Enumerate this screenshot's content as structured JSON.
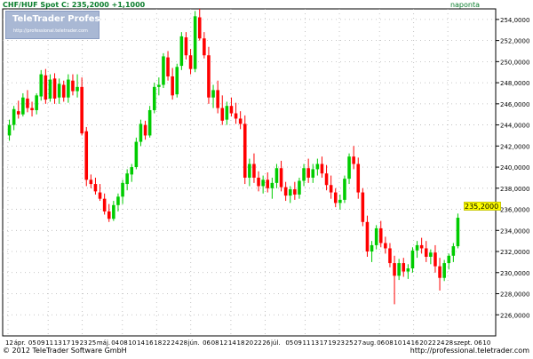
{
  "header": {
    "symbol_line": "CHF/HUF Spot C: 235,2000 +1,1000",
    "frequency": "naponta"
  },
  "logo": {
    "title": "TeleTrader Professional",
    "url": "http://professional.teletrader.com"
  },
  "footer": {
    "copyright": "© 2012 TeleTrader Software GmbH",
    "url": "http://professional.teletrader.com"
  },
  "colors": {
    "up": "#00cc00",
    "down": "#ff0000",
    "grid": "#b5b5b5",
    "axis": "#000000",
    "last_price_bg": "#ffff00"
  },
  "chart_data": {
    "type": "candlestick",
    "title": "CHF/HUF Spot",
    "last_price_label": "235,2000",
    "ylim": [
      224,
      255
    ],
    "y_ticks": [
      "226,0000",
      "228,0000",
      "230,0000",
      "232,0000",
      "234,0000",
      "236,0000",
      "238,0000",
      "240,0000",
      "242,0000",
      "244,0000",
      "246,0000",
      "248,0000",
      "250,0000",
      "252,0000",
      "254,0000"
    ],
    "x_tick_labels": [
      "12",
      "ápr.",
      "05",
      "09",
      "11",
      "13",
      "17",
      "19",
      "23",
      "25",
      "máj.",
      "04",
      "08",
      "10",
      "14",
      "16",
      "18",
      "22",
      "24",
      "28",
      "jún.",
      "06",
      "08",
      "12",
      "14",
      "18",
      "20",
      "22",
      "26",
      "júl.",
      "05",
      "09",
      "11",
      "13",
      "17",
      "19",
      "23",
      "25",
      "27",
      "aug.",
      "06",
      "08",
      "10",
      "14",
      "16",
      "20",
      "22",
      "24",
      "28",
      "szept.",
      "06",
      "10"
    ],
    "grid": true,
    "axis_side": "right",
    "candles": [
      [
        243.0,
        244.5,
        242.5,
        244.0
      ],
      [
        244.0,
        245.8,
        243.5,
        245.5
      ],
      [
        245.3,
        246.3,
        244.6,
        245.0
      ],
      [
        245.0,
        247.0,
        244.8,
        246.6
      ],
      [
        246.5,
        247.3,
        245.2,
        245.6
      ],
      [
        245.6,
        246.2,
        244.8,
        245.4
      ],
      [
        245.4,
        247.0,
        245.0,
        246.8
      ],
      [
        246.7,
        249.2,
        246.3,
        248.8
      ],
      [
        248.7,
        249.3,
        246.0,
        246.4
      ],
      [
        246.5,
        248.8,
        246.2,
        248.3
      ],
      [
        248.4,
        248.9,
        246.0,
        246.5
      ],
      [
        246.6,
        248.4,
        246.0,
        247.9
      ],
      [
        247.8,
        248.2,
        246.2,
        246.6
      ],
      [
        246.6,
        248.8,
        246.1,
        248.3
      ],
      [
        248.2,
        248.8,
        246.8,
        247.2
      ],
      [
        247.2,
        248.8,
        246.6,
        247.6
      ],
      [
        247.6,
        248.5,
        243.0,
        243.2
      ],
      [
        243.4,
        243.8,
        238.2,
        238.8
      ],
      [
        238.8,
        239.3,
        238.0,
        238.4
      ],
      [
        238.4,
        239.0,
        237.4,
        237.7
      ],
      [
        237.6,
        238.4,
        236.8,
        237.0
      ],
      [
        237.0,
        237.5,
        235.5,
        235.8
      ],
      [
        235.8,
        236.5,
        234.8,
        235.1
      ],
      [
        235.1,
        236.8,
        234.9,
        236.4
      ],
      [
        236.4,
        237.5,
        235.8,
        237.2
      ],
      [
        237.2,
        238.8,
        236.5,
        238.5
      ],
      [
        238.4,
        239.8,
        237.8,
        239.4
      ],
      [
        239.3,
        240.3,
        238.6,
        240.0
      ],
      [
        240.0,
        242.8,
        239.8,
        242.4
      ],
      [
        242.4,
        244.5,
        242.0,
        244.1
      ],
      [
        244.0,
        244.4,
        242.6,
        243.0
      ],
      [
        243.0,
        245.8,
        242.8,
        245.4
      ],
      [
        245.4,
        248.0,
        245.1,
        247.6
      ],
      [
        247.6,
        248.5,
        246.8,
        247.8
      ],
      [
        247.8,
        250.8,
        247.5,
        250.5
      ],
      [
        250.4,
        251.0,
        248.2,
        248.6
      ],
      [
        248.6,
        249.4,
        246.4,
        246.8
      ],
      [
        246.9,
        249.8,
        246.6,
        249.5
      ],
      [
        249.6,
        252.8,
        249.2,
        252.4
      ],
      [
        252.3,
        252.8,
        250.2,
        250.6
      ],
      [
        250.6,
        251.2,
        248.8,
        249.3
      ],
      [
        249.3,
        254.8,
        249.0,
        254.3
      ],
      [
        254.2,
        255.0,
        252.0,
        252.2
      ],
      [
        252.2,
        252.8,
        250.3,
        250.6
      ],
      [
        250.6,
        251.4,
        246.0,
        246.6
      ],
      [
        246.6,
        247.8,
        245.6,
        247.3
      ],
      [
        247.3,
        248.2,
        245.1,
        245.6
      ],
      [
        245.6,
        246.8,
        244.0,
        244.4
      ],
      [
        244.5,
        246.2,
        244.0,
        245.8
      ],
      [
        245.8,
        246.6,
        244.8,
        245.1
      ],
      [
        245.1,
        246.1,
        244.1,
        244.6
      ],
      [
        244.6,
        245.3,
        243.6,
        244.1
      ],
      [
        244.1,
        244.9,
        238.4,
        239.0
      ],
      [
        239.0,
        240.8,
        238.2,
        240.3
      ],
      [
        240.3,
        241.3,
        238.5,
        239.0
      ],
      [
        239.0,
        239.6,
        237.7,
        238.2
      ],
      [
        238.2,
        239.2,
        237.5,
        238.8
      ],
      [
        238.8,
        239.5,
        237.6,
        238.0
      ],
      [
        238.0,
        239.0,
        237.0,
        238.5
      ],
      [
        238.5,
        240.3,
        238.0,
        239.9
      ],
      [
        239.9,
        240.6,
        237.7,
        238.1
      ],
      [
        238.1,
        238.6,
        236.8,
        237.3
      ],
      [
        237.3,
        238.2,
        236.6,
        237.9
      ],
      [
        237.9,
        238.6,
        236.9,
        237.4
      ],
      [
        237.4,
        239.0,
        237.0,
        238.7
      ],
      [
        238.7,
        240.3,
        238.2,
        239.9
      ],
      [
        239.9,
        240.8,
        238.5,
        239.0
      ],
      [
        239.0,
        240.3,
        238.5,
        239.8
      ],
      [
        239.8,
        240.8,
        239.2,
        240.3
      ],
      [
        240.3,
        241.0,
        239.0,
        239.4
      ],
      [
        239.4,
        240.2,
        237.8,
        238.3
      ],
      [
        238.3,
        239.2,
        237.0,
        237.6
      ],
      [
        237.6,
        238.0,
        236.2,
        236.6
      ],
      [
        236.6,
        237.4,
        236.0,
        236.9
      ],
      [
        236.9,
        239.2,
        236.6,
        238.9
      ],
      [
        238.9,
        241.3,
        238.4,
        241.0
      ],
      [
        241.0,
        242.0,
        239.8,
        240.3
      ],
      [
        240.3,
        240.9,
        237.0,
        237.6
      ],
      [
        237.6,
        238.0,
        234.4,
        234.8
      ],
      [
        234.8,
        235.4,
        231.5,
        232.0
      ],
      [
        232.0,
        233.0,
        231.0,
        232.6
      ],
      [
        232.6,
        234.5,
        232.2,
        234.2
      ],
      [
        234.2,
        234.9,
        232.4,
        232.8
      ],
      [
        232.8,
        233.4,
        231.8,
        232.3
      ],
      [
        232.3,
        232.8,
        230.5,
        230.9
      ],
      [
        230.9,
        231.6,
        227.0,
        229.7
      ],
      [
        229.7,
        231.3,
        229.3,
        230.9
      ],
      [
        230.9,
        231.4,
        229.6,
        230.1
      ],
      [
        230.1,
        230.8,
        229.4,
        230.4
      ],
      [
        230.4,
        232.4,
        230.0,
        232.1
      ],
      [
        232.1,
        233.0,
        231.4,
        232.6
      ],
      [
        232.6,
        233.3,
        231.8,
        232.3
      ],
      [
        232.3,
        233.0,
        231.0,
        231.5
      ],
      [
        231.5,
        232.2,
        230.8,
        231.9
      ],
      [
        231.9,
        232.6,
        230.0,
        230.6
      ],
      [
        230.6,
        231.4,
        228.3,
        229.5
      ],
      [
        229.5,
        231.2,
        229.2,
        230.9
      ],
      [
        230.9,
        231.8,
        230.3,
        231.6
      ],
      [
        231.6,
        232.8,
        231.0,
        232.5
      ],
      [
        232.5,
        235.6,
        232.3,
        235.2
      ]
    ]
  }
}
